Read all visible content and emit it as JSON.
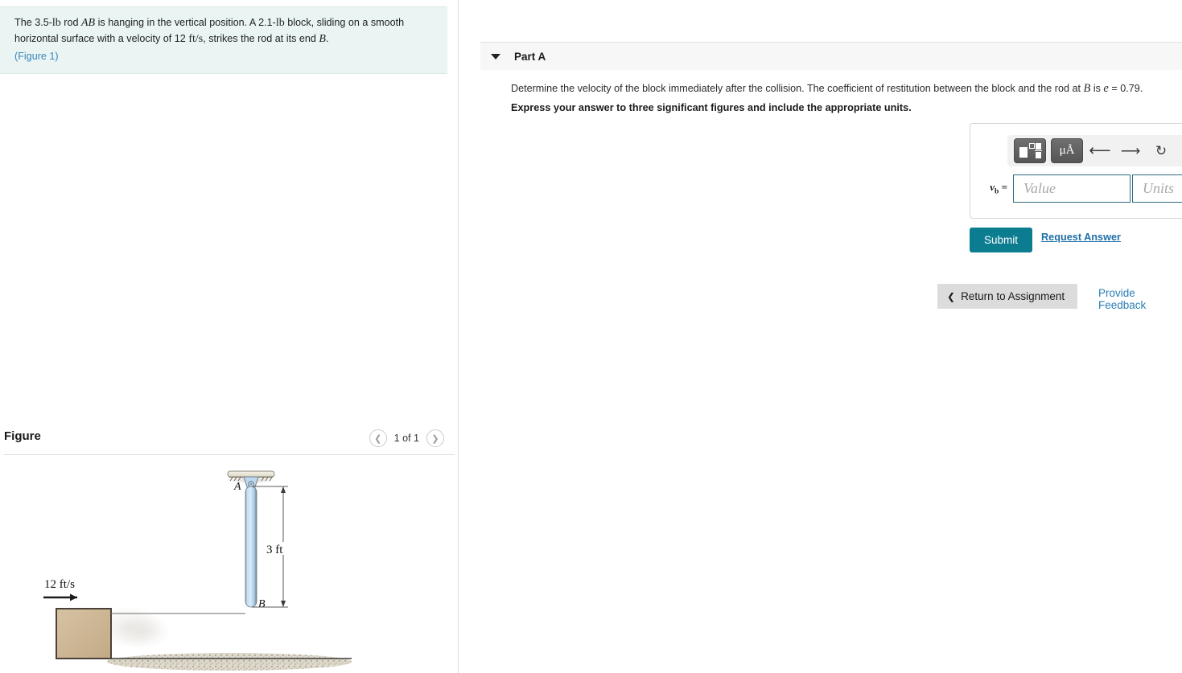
{
  "problem": {
    "text_part1": "The 3.5-",
    "lb1": "lb",
    "text_part2": " rod ",
    "rod_label": "AB",
    "text_part3": " is hanging in the vertical position. A 2.1-",
    "lb2": "lb",
    "text_part4": " block, sliding on a smooth horizontal surface with a velocity of 12 ",
    "units_fts": "ft/s",
    "text_part5": ", strikes the rod at its end ",
    "end_label": "B",
    "text_part6": ".",
    "figure_link": "(Figure 1)",
    "background_color": "#e9f4f3"
  },
  "figure_panel": {
    "title": "Figure",
    "prev_icon": "chevron-left-icon",
    "next_icon": "chevron-right-icon",
    "counter": "1 of 1"
  },
  "figure": {
    "point_a": "A",
    "point_b": "B",
    "length_label": "3 ft",
    "velocity_label": "12 ft/s",
    "rod_color": "#b9d9ef",
    "rod_edge_color": "#6f7d87",
    "block_color": "#cdb694",
    "block_border_color": "#4a4238",
    "ground_color": "#d9d2c4",
    "mount_color": "#eceadd"
  },
  "part_a": {
    "collapse_icon": "caret-down-icon",
    "label": "Part A",
    "question_prefix": "Determine the velocity of the block immediately after the collision. The coefficient of restitution between the block and the rod at ",
    "question_var": "B",
    "question_mid": " is ",
    "question_e": "e",
    "question_suffix": " = 0.79.",
    "instruction": "Express your answer to three significant figures and include the appropriate units."
  },
  "answer_widget": {
    "template_button_icon": "math-template-icon",
    "units_button_label": "μÅ",
    "units_button_icon": "units-icon",
    "undo_icon": "undo-arrow-icon",
    "redo_icon": "redo-arrow-icon",
    "reset_icon": "reset-circular-arrow-icon",
    "keyboard_icon": "keyboard-icon",
    "help_label": "?",
    "help_icon": "help-question-icon",
    "variable_base": "v",
    "variable_sub": "b",
    "equals": "=",
    "value_placeholder": "Value",
    "value_text": "",
    "units_placeholder": "Units",
    "units_text": "",
    "input_border_color": "#2b6b80"
  },
  "actions": {
    "submit_label": "Submit",
    "submit_color": "#0c7c91",
    "request_answer_label": "Request Answer",
    "return_label": "Return to Assignment",
    "return_chevron_icon": "chevron-left-icon",
    "feedback_label": "Provide Feedback"
  }
}
